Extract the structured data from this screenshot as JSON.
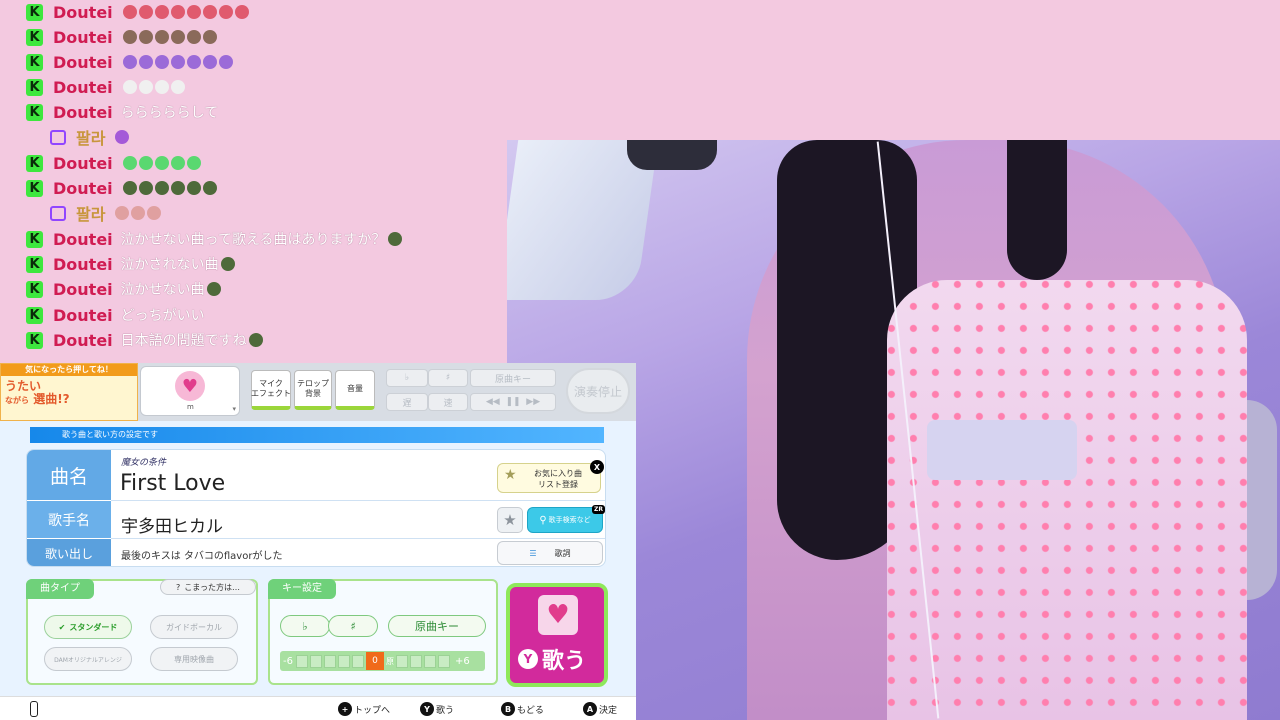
{
  "chat": {
    "messages": [
      {
        "platform": "kick",
        "user": "Doutei",
        "text": "",
        "emotes": [
          "#e05a6e",
          "#e05a6e",
          "#e05a6e",
          "#e05a6e",
          "#e05a6e",
          "#e05a6e",
          "#e05a6e",
          "#e05a6e"
        ]
      },
      {
        "platform": "kick",
        "user": "Doutei",
        "text": "",
        "emotes": [
          "#8a6a5a",
          "#8a6a5a",
          "#8a6a5a",
          "#8a6a5a",
          "#8a6a5a",
          "#8a6a5a"
        ]
      },
      {
        "platform": "kick",
        "user": "Doutei",
        "text": "",
        "emotes": [
          "#9b6ad8",
          "#9b6ad8",
          "#9b6ad8",
          "#9b6ad8",
          "#9b6ad8",
          "#9b6ad8",
          "#9b6ad8"
        ]
      },
      {
        "platform": "kick",
        "user": "Doutei",
        "text": "",
        "emotes": [
          "#f0f0f0",
          "#f0f0f0",
          "#f0f0f0",
          "#f0f0f0"
        ]
      },
      {
        "platform": "kick",
        "user": "Doutei",
        "text": "らららららして",
        "emotes": []
      },
      {
        "platform": "twitch",
        "user": "팔라",
        "text": "",
        "emotes": [
          "#a45ad8"
        ]
      },
      {
        "platform": "kick",
        "user": "Doutei",
        "text": "",
        "emotes": [
          "#5ad870",
          "#5ad870",
          "#5ad870",
          "#5ad870",
          "#5ad870"
        ]
      },
      {
        "platform": "kick",
        "user": "Doutei",
        "text": "",
        "emotes": [
          "#4e6a3a",
          "#4e6a3a",
          "#4e6a3a",
          "#4e6a3a",
          "#4e6a3a",
          "#4e6a3a"
        ]
      },
      {
        "platform": "twitch",
        "user": "팔라",
        "text": "",
        "emotes": [
          "#e0a0a0",
          "#e0a0a0",
          "#e0a0a0"
        ]
      },
      {
        "platform": "kick",
        "user": "Doutei",
        "text": "泣かせない曲って歌える曲はありますか？",
        "emotes": [
          "#4e6a3a"
        ]
      },
      {
        "platform": "kick",
        "user": "Doutei",
        "text": "泣かされない曲",
        "emotes": [
          "#4e6a3a"
        ]
      },
      {
        "platform": "kick",
        "user": "Doutei",
        "text": "泣かせない曲",
        "emotes": [
          "#4e6a3a"
        ]
      },
      {
        "platform": "kick",
        "user": "Doutei",
        "text": "どっちがいい",
        "emotes": []
      },
      {
        "platform": "kick",
        "user": "Doutei",
        "text": "日本語の問題ですね",
        "emotes": [
          "#4e6a3a"
        ]
      }
    ]
  },
  "karaoke": {
    "promo_header": "気になったら押してね！",
    "promo_line1": "うたい",
    "promo_line2": "ながら",
    "promo_line3": "選曲!?",
    "mic_effect": "マイク\nエフェクト",
    "telop": "テロップ\n背景",
    "volume": "音量",
    "flat": "♭",
    "sharp": "♯",
    "original_key_top": "原曲キー",
    "tempo_slow": "遅",
    "tempo_fast": "速",
    "stop_label": "演奏停止",
    "section_title": "歌う曲と歌い方の設定です",
    "label_song": "曲名",
    "label_artist": "歌手名",
    "label_lyric_start": "歌い出し",
    "song_subtitle": "魔女の条件",
    "song_title": "First Love",
    "artist": "宇多田ヒカル",
    "lyric_start": "最後のキスは タバコのflavorがした",
    "fav_button": "お気に入り曲\nリスト登録",
    "fav_badge": "X",
    "artist_search": "歌手検索など",
    "artist_search_badge": "ZR",
    "lyrics_button": "歌詞",
    "song_type_tab": "曲タイプ",
    "help_button": "こまった方は…",
    "type_standard": "スタンダード",
    "type_guide_vocal": "ガイドボーカル",
    "type_arrange": "DAMオリジナルアレンジ",
    "type_exclusive": "専用映像曲",
    "key_tab": "キー設定",
    "key_flat": "♭",
    "key_sharp": "♯",
    "key_original": "原曲キー",
    "key_min": "-6",
    "key_max": "+6",
    "key_current": "0",
    "key_orig_marker": "原",
    "sing_button": "歌う",
    "sing_badge": "Y",
    "footer_plus": "+",
    "footer_top": "トップへ",
    "footer_y": "Y",
    "footer_sing": "歌う",
    "footer_b": "B",
    "footer_back": "もどる",
    "footer_a": "A",
    "footer_confirm": "決定",
    "avatar_name": "m"
  },
  "colors": {
    "background": "#f3c9e0",
    "kick_green": "#3ee73e",
    "twitch_purple": "#9146ff",
    "sing_magenta": "#d22a9c"
  }
}
